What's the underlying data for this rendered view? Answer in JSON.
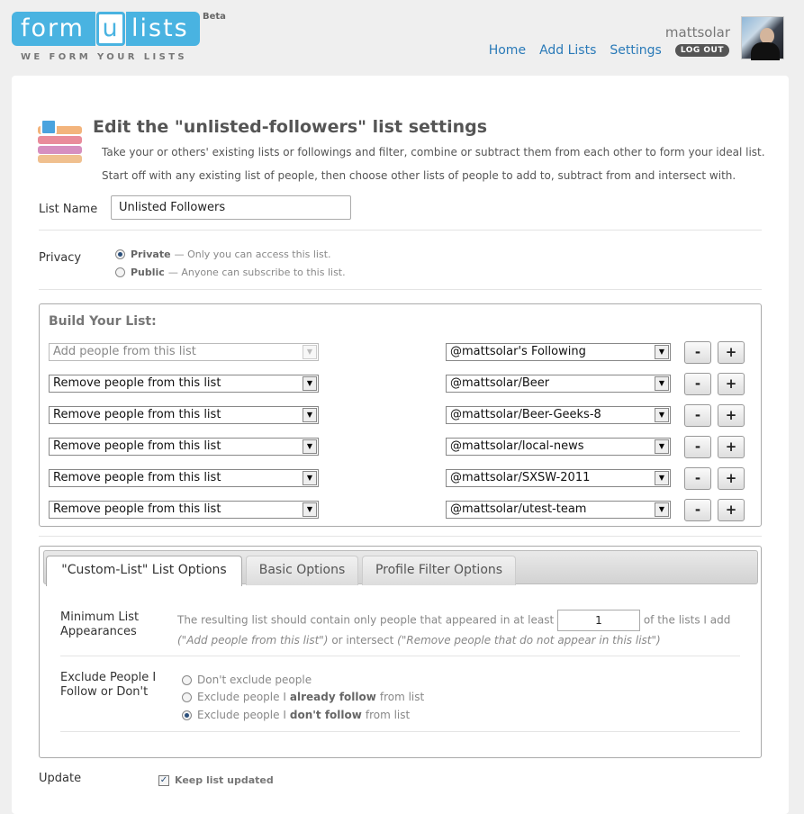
{
  "header": {
    "logo": {
      "part1": "form",
      "part2": "u",
      "part3": "lists"
    },
    "beta": "Beta",
    "tagline": "WE FORM YOUR LISTS",
    "username": "mattsolar",
    "nav": {
      "home": "Home",
      "add_lists": "Add Lists",
      "settings": "Settings",
      "logout": "LOG OUT"
    }
  },
  "page": {
    "title": "Edit the \"unlisted-followers\" list settings",
    "desc1": "Take your or others' existing lists or followings and filter, combine or subtract them from each other to form your ideal list.",
    "desc2": "Start off with any existing list of people, then choose other lists of people to add to, subtract from and intersect with."
  },
  "list_name": {
    "label": "List Name",
    "value": "Unlisted Followers"
  },
  "privacy": {
    "label": "Privacy",
    "private": {
      "title": "Private",
      "desc": "— Only you can access this list.",
      "checked": true
    },
    "public": {
      "title": "Public",
      "desc": "— Anyone can subscribe to this list.",
      "checked": false
    }
  },
  "build": {
    "title": "Build Your List:",
    "rows": [
      {
        "action": "Add people from this list",
        "list": "@mattsolar's Following",
        "disabled": true
      },
      {
        "action": "Remove people from this list",
        "list": "@mattsolar/Beer",
        "disabled": false
      },
      {
        "action": "Remove people from this list",
        "list": "@mattsolar/Beer-Geeks-8",
        "disabled": false
      },
      {
        "action": "Remove people from this list",
        "list": "@mattsolar/local-news",
        "disabled": false
      },
      {
        "action": "Remove people from this list",
        "list": "@mattsolar/SXSW-2011",
        "disabled": false
      },
      {
        "action": "Remove people from this list",
        "list": "@mattsolar/utest-team",
        "disabled": false
      }
    ],
    "minus": "-",
    "plus": "+"
  },
  "options": {
    "tabs": [
      "\"Custom-List\" List Options",
      "Basic Options",
      "Profile Filter Options"
    ],
    "active_tab": 0,
    "min_appearances": {
      "label_line1": "Minimum List",
      "label_line2": "Appearances",
      "text_before": "The resulting list should contain only people that appeared in at least",
      "value": "1",
      "text_after": "of the lists I add",
      "note1": "(\"Add people from this list\")",
      "text_or": "or intersect",
      "note2": "(\"Remove people that do not appear in this list\")"
    },
    "exclude": {
      "label_line1": "Exclude People I",
      "label_line2": "Follow or Don't",
      "opt1": "Don't exclude people",
      "opt2_pre": "Exclude people I",
      "opt2_bold": "already follow",
      "opt2_post": "from list",
      "opt3_pre": "Exclude people I",
      "opt3_bold": "don't follow",
      "opt3_post": "from list",
      "selected": 3
    }
  },
  "update": {
    "label": "Update",
    "checkbox_label": "Keep list updated",
    "checked": true
  },
  "colors": {
    "brand": "#49b3e1",
    "link": "#2a7ab8"
  }
}
